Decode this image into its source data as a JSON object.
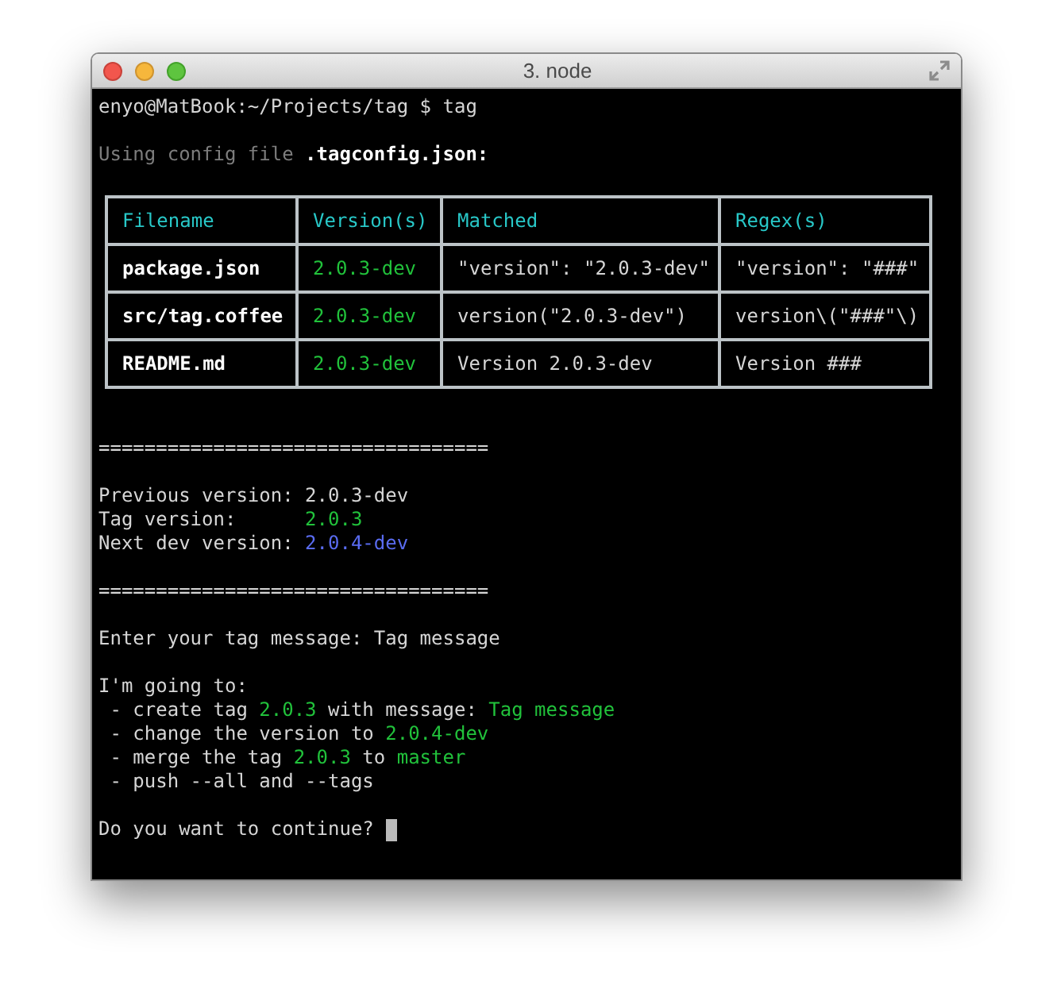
{
  "window": {
    "title": "3. node"
  },
  "terminal": {
    "lines_before": [
      {
        "kind": "text",
        "segments": [
          {
            "kind": "plain",
            "text": "enyo@MatBook:~/Projects/tag $ tag"
          }
        ]
      },
      {
        "kind": "blank"
      },
      {
        "kind": "text",
        "segments": [
          {
            "kind": "dim",
            "text": "Using config file "
          },
          {
            "kind": "bold",
            "text": ".tagconfig.json:"
          }
        ]
      },
      {
        "kind": "blank"
      }
    ],
    "table": {
      "columns": [
        "Filename",
        "Version(s)",
        "Matched",
        "Regex(s)"
      ],
      "rows": [
        [
          {
            "kind": "bold",
            "text": "package.json"
          },
          {
            "kind": "green",
            "text": "2.0.3-dev"
          },
          {
            "kind": "plain",
            "text": "\"version\": \"2.0.3-dev\""
          },
          {
            "kind": "plain",
            "text": "\"version\": \"###\""
          }
        ],
        [
          {
            "kind": "bold",
            "text": "src/tag.coffee"
          },
          {
            "kind": "green",
            "text": "2.0.3-dev"
          },
          {
            "kind": "plain",
            "text": "version(\"2.0.3-dev\")"
          },
          {
            "kind": "plain",
            "text": "version\\(\"###\"\\)"
          }
        ],
        [
          {
            "kind": "bold",
            "text": "README.md"
          },
          {
            "kind": "green",
            "text": "2.0.3-dev"
          },
          {
            "kind": "plain",
            "text": "Version 2.0.3-dev"
          },
          {
            "kind": "plain",
            "text": "Version ###"
          }
        ]
      ]
    },
    "lines_after": [
      {
        "kind": "blank"
      },
      {
        "kind": "blank"
      },
      {
        "kind": "text",
        "segments": [
          {
            "kind": "plain",
            "text": "=================================="
          }
        ]
      },
      {
        "kind": "blank"
      },
      {
        "kind": "text",
        "segments": [
          {
            "kind": "plain",
            "text": "Previous version: 2.0.3-dev"
          }
        ]
      },
      {
        "kind": "text",
        "segments": [
          {
            "kind": "plain",
            "text": "Tag version:      "
          },
          {
            "kind": "green",
            "text": "2.0.3"
          }
        ]
      },
      {
        "kind": "text",
        "segments": [
          {
            "kind": "plain",
            "text": "Next dev version: "
          },
          {
            "kind": "blue",
            "text": "2.0.4-dev"
          }
        ]
      },
      {
        "kind": "blank"
      },
      {
        "kind": "text",
        "segments": [
          {
            "kind": "plain",
            "text": "=================================="
          }
        ]
      },
      {
        "kind": "blank"
      },
      {
        "kind": "text",
        "segments": [
          {
            "kind": "plain",
            "text": "Enter your tag message: Tag message"
          }
        ]
      },
      {
        "kind": "blank"
      },
      {
        "kind": "text",
        "segments": [
          {
            "kind": "plain",
            "text": "I'm going to:"
          }
        ]
      },
      {
        "kind": "text",
        "segments": [
          {
            "kind": "plain",
            "text": " - create tag "
          },
          {
            "kind": "green",
            "text": "2.0.3"
          },
          {
            "kind": "plain",
            "text": " with message: "
          },
          {
            "kind": "green",
            "text": "Tag message"
          }
        ]
      },
      {
        "kind": "text",
        "segments": [
          {
            "kind": "plain",
            "text": " - change the version to "
          },
          {
            "kind": "green",
            "text": "2.0.4-dev"
          }
        ]
      },
      {
        "kind": "text",
        "segments": [
          {
            "kind": "plain",
            "text": " - merge the tag "
          },
          {
            "kind": "green",
            "text": "2.0.3"
          },
          {
            "kind": "plain",
            "text": " to "
          },
          {
            "kind": "green",
            "text": "master"
          }
        ]
      },
      {
        "kind": "text",
        "segments": [
          {
            "kind": "plain",
            "text": " - push --all and --tags"
          }
        ]
      },
      {
        "kind": "blank"
      },
      {
        "kind": "prompt",
        "segments": [
          {
            "kind": "plain",
            "text": "Do you want to continue? "
          }
        ]
      }
    ]
  }
}
